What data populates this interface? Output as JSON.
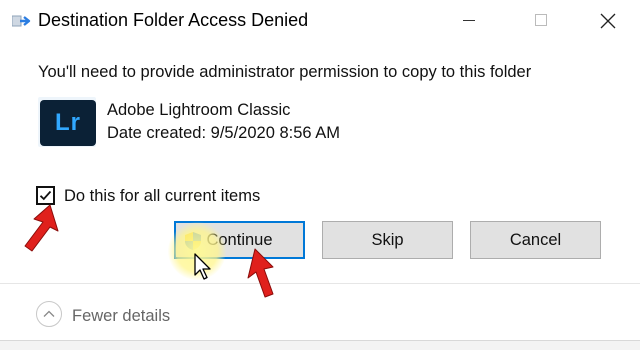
{
  "window": {
    "title": "Destination Folder Access Denied"
  },
  "dialog": {
    "message": "You'll need to provide administrator permission to copy to this folder",
    "file": {
      "icon_text": "Lr",
      "name": "Adobe Lightroom Classic",
      "date_created": "Date created: 9/5/2020 8:56 AM"
    },
    "apply_all": {
      "label": "Do this for all current items",
      "checked": true
    },
    "buttons": {
      "continue": "Continue",
      "skip": "Skip",
      "cancel": "Cancel"
    },
    "footer": {
      "toggle_label": "Fewer details"
    }
  },
  "colors": {
    "accent": "#0078d7",
    "button_bg": "#e1e1e1",
    "annotation_arrow": "#e0201c",
    "lr_icon_bg": "#0b2136",
    "lr_icon_text": "#31a8ff"
  },
  "icons": [
    "copy-move-icon",
    "minimize-icon",
    "maximize-icon",
    "close-icon",
    "lightroom-icon",
    "checkmark-icon",
    "uac-shield-icon",
    "chevron-up-icon",
    "mouse-cursor-icon",
    "red-arrow-icon"
  ]
}
